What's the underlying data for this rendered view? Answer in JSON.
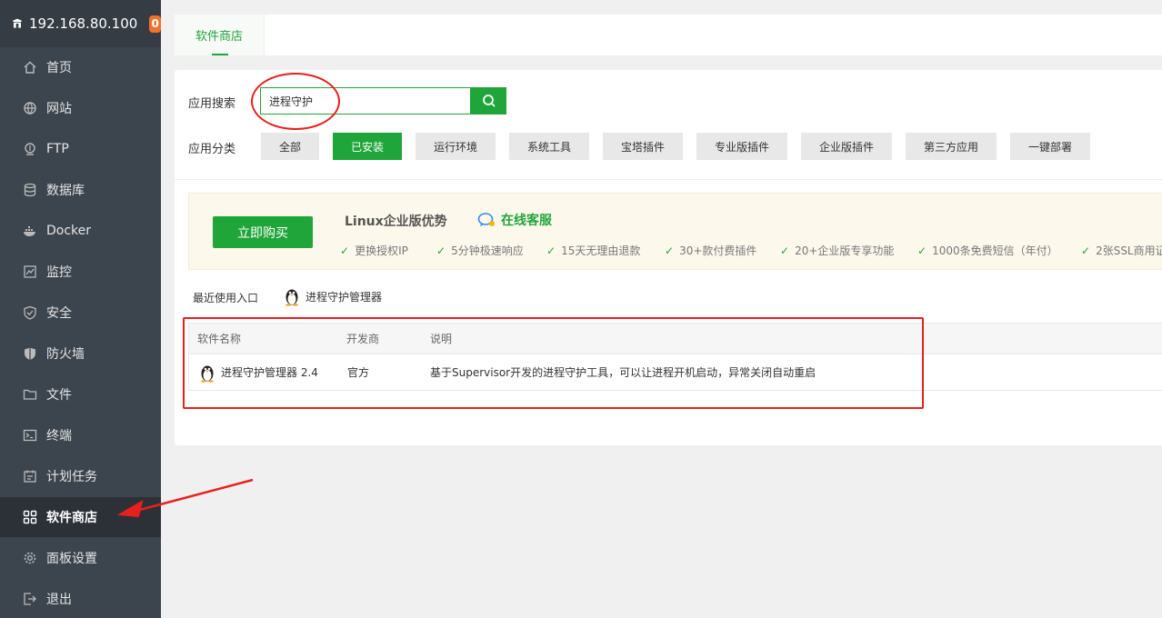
{
  "sidebar": {
    "host": "192.168.80.100",
    "badge": "0",
    "items": [
      {
        "label": "首页"
      },
      {
        "label": "网站"
      },
      {
        "label": "FTP"
      },
      {
        "label": "数据库"
      },
      {
        "label": "Docker"
      },
      {
        "label": "监控"
      },
      {
        "label": "安全"
      },
      {
        "label": "防火墙"
      },
      {
        "label": "文件"
      },
      {
        "label": "终端"
      },
      {
        "label": "计划任务"
      },
      {
        "label": "软件商店"
      },
      {
        "label": "面板设置"
      },
      {
        "label": "退出"
      }
    ],
    "active_index": 11
  },
  "tabs": [
    {
      "label": "软件商店"
    }
  ],
  "search": {
    "label": "应用搜索",
    "value": "进程守护",
    "placeholder": ""
  },
  "categories": {
    "label": "应用分类",
    "items": [
      "全部",
      "已安装",
      "运行环境",
      "系统工具",
      "宝塔插件",
      "专业版插件",
      "企业版插件",
      "第三方应用",
      "一键部署"
    ],
    "active_index": 1
  },
  "promo": {
    "buy_label": "立即购买",
    "title": "Linux企业版优势",
    "cs_label": "在线客服",
    "features": [
      "更换授权IP",
      "5分钟极速响应",
      "15天无理由退款",
      "30+款付费插件",
      "20+企业版专享功能",
      "1000条免费短信（年付）",
      "2张SSL商用证"
    ]
  },
  "recent": {
    "label": "最近使用入口",
    "item": "进程守护管理器"
  },
  "table": {
    "headers": [
      "软件名称",
      "开发商",
      "说明"
    ],
    "rows": [
      {
        "name": "进程守护管理器 2.4",
        "vendor": "官方",
        "desc": "基于Supervisor开发的进程守护工具，可以让进程开机启动，异常关闭自动重启"
      }
    ]
  },
  "colors": {
    "accent": "#20a53a",
    "sidebar_bg": "#3c444d",
    "badge": "#f0712c",
    "annotation": "#e8201c"
  }
}
